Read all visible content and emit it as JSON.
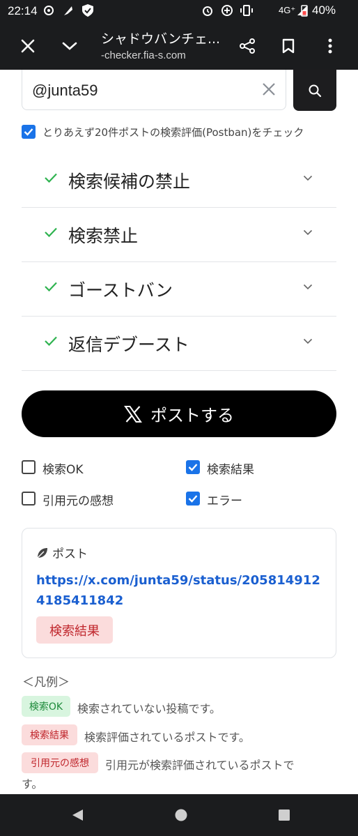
{
  "status_bar": {
    "time": "22:14",
    "network": "4G⁺",
    "battery": "40%",
    "icons": [
      "threads-icon",
      "feather-icon",
      "shield-icon",
      "alarm-icon",
      "data-saver-icon",
      "vibrate-icon",
      "signal-icon",
      "battery-icon"
    ]
  },
  "toolbar": {
    "title": "シャドウバンチェ...",
    "url": "-checker.fia-s.com",
    "icons": [
      "close-icon",
      "chevron-down-icon",
      "share-icon",
      "bookmark-icon",
      "more-vert-icon"
    ]
  },
  "search": {
    "value": "@junta59",
    "button_icon": "search-icon"
  },
  "option": {
    "label": "とりあえず20件ポストの検索評価(Postban)をチェック",
    "checked": true
  },
  "checks": [
    {
      "label": "検索候補の禁止"
    },
    {
      "label": "検索禁止"
    },
    {
      "label": "ゴーストバン"
    },
    {
      "label": "返信デブースト"
    }
  ],
  "post_button": {
    "label": "ポストする",
    "icon": "x-logo-icon"
  },
  "filters": [
    {
      "label": "検索OK",
      "checked": false
    },
    {
      "label": "検索結果",
      "checked": true
    },
    {
      "label": "引用元の感想",
      "checked": false
    },
    {
      "label": "エラー",
      "checked": true
    }
  ],
  "result_card": {
    "header": "ポスト",
    "header_icon": "leaf-icon",
    "link": "https://x.com/junta59/status/2058149124185411842",
    "badge": "検索結果"
  },
  "legend": {
    "title": "＜凡例＞",
    "items": [
      {
        "badge": "検索OK",
        "text": "検索されていない投稿です。",
        "color": "green"
      },
      {
        "badge": "検索結果",
        "text": "検索評価されているポストです。",
        "color": "red"
      },
      {
        "badge": "引用元の感想",
        "text_line1": "引用元が検索評価されているポストで",
        "text_line2": "す。",
        "color": "red"
      }
    ]
  },
  "colors": {
    "accent": "#1a73e8",
    "check_green": "#2fb350",
    "link": "#1a5fd0",
    "bar": "#1b1c1e"
  }
}
